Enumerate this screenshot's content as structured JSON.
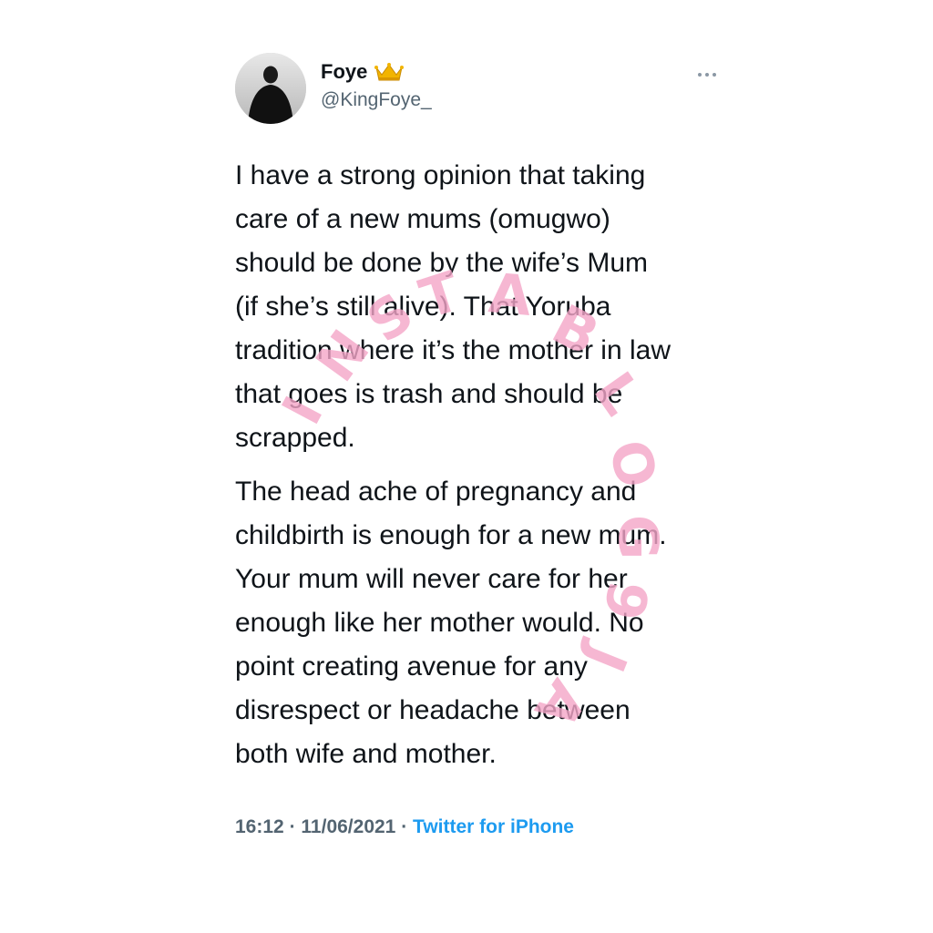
{
  "tweet": {
    "display_name": "Foye",
    "display_name_emoji_icon": "crown-icon",
    "handle": "@KingFoye_",
    "more_icon": "more-horizontal-icon",
    "paragraph_1": "I have a strong opinion that taking\ncare of a new mums (omugwo)\nshould be done by the wife’s Mum\n(if she’s still alive). That Yoruba\ntradition where it’s the mother in law\nthat goes is trash and should be\nscrapped.",
    "paragraph_2": "The head ache of pregnancy and\nchildbirth is enough for a new mum.\nYour mum will never care for her\nenough like her mother would. No\npoint creating avenue for any\ndisrespect or headache between\nboth wife and mother.",
    "time": "16:12",
    "date": "11/06/2021",
    "separator": "·",
    "source": "Twitter for iPhone"
  },
  "watermark": {
    "text_1": "INSTABLOG9JA",
    "color": "#f4a6c8"
  },
  "colors": {
    "text_primary": "#0f1419",
    "text_secondary": "#536471",
    "link": "#1d9bf0"
  }
}
